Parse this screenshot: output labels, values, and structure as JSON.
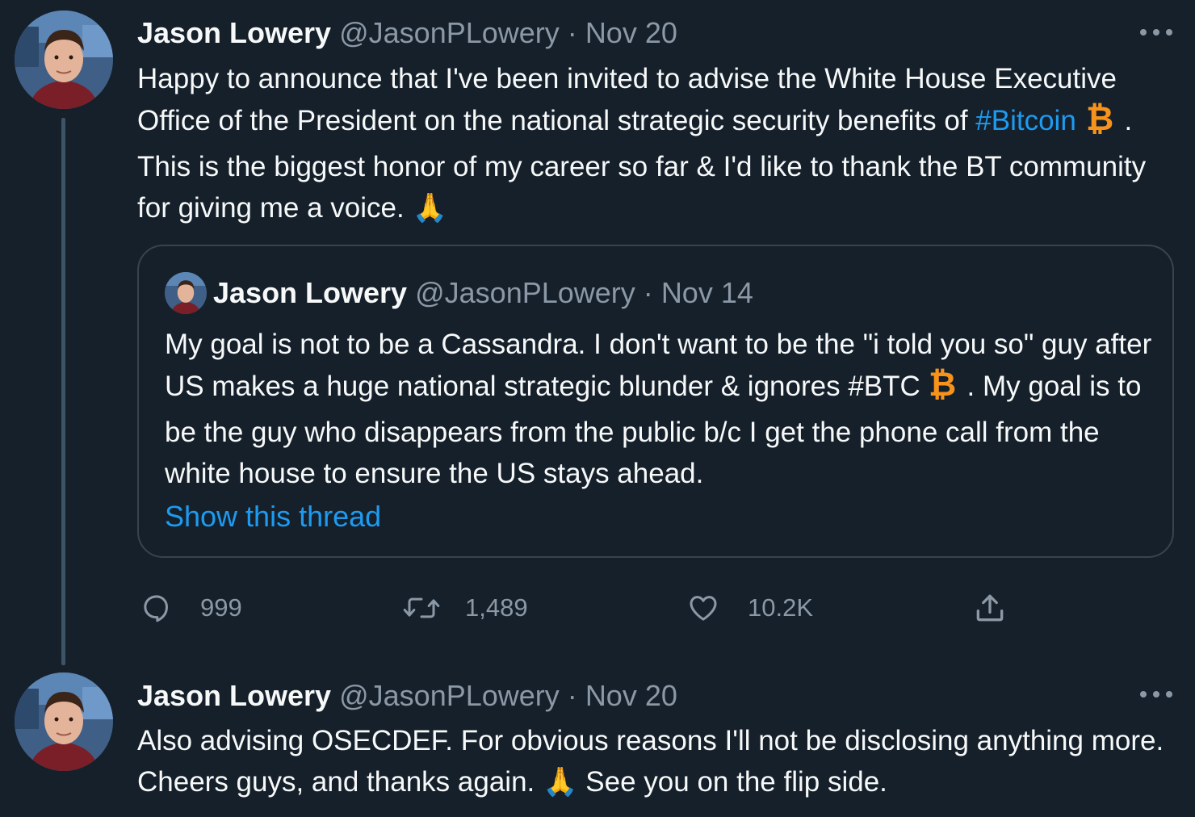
{
  "tweet1": {
    "name": "Jason Lowery",
    "handle": "@JasonPLowery",
    "sep": "·",
    "date": "Nov 20",
    "text_a": "Happy to announce that I've been invited to advise the White House Executive Office of the President on the national strategic security benefits of ",
    "hashtag": "#Bitcoin",
    "text_b": " . This is the biggest honor of my career so far & I'd like to thank the BT community for giving me a voice. ",
    "emoji_pray": "🙏",
    "quote": {
      "name": "Jason Lowery",
      "handle": "@JasonPLowery",
      "sep": "·",
      "date": "Nov 14",
      "text_a": "My goal is not to be a Cassandra. I don't want to be the \"i told you so\" guy after US makes a huge national strategic blunder & ignores ",
      "hashtag": "#BTC",
      "text_b": " . My goal is to be the guy who disappears from the public b/c I get the phone call from the white house to ensure the US stays ahead.",
      "show_thread": "Show this thread"
    },
    "actions": {
      "replies": "999",
      "retweets": "1,489",
      "likes": "10.2K"
    }
  },
  "tweet2": {
    "name": "Jason Lowery",
    "handle": "@JasonPLowery",
    "sep": "·",
    "date": "Nov 20",
    "text_a": "Also advising OSECDEF. For obvious reasons I'll not be disclosing anything more. Cheers guys, and thanks again. ",
    "emoji_pray": "🙏",
    "text_b": " See you on the flip side."
  },
  "icons": {
    "reply": "reply-icon",
    "retweet": "retweet-icon",
    "like": "heart-icon",
    "share": "share-icon",
    "more": "more-icon",
    "bitcoin": "bitcoin-icon",
    "pray": "pray-emoji-icon"
  },
  "colors": {
    "background": "#15202b",
    "text": "#f7f9f9",
    "secondary": "#8b98a5",
    "link": "#1d9bf0",
    "bitcoin": "#f7931a",
    "border": "#38444d"
  }
}
